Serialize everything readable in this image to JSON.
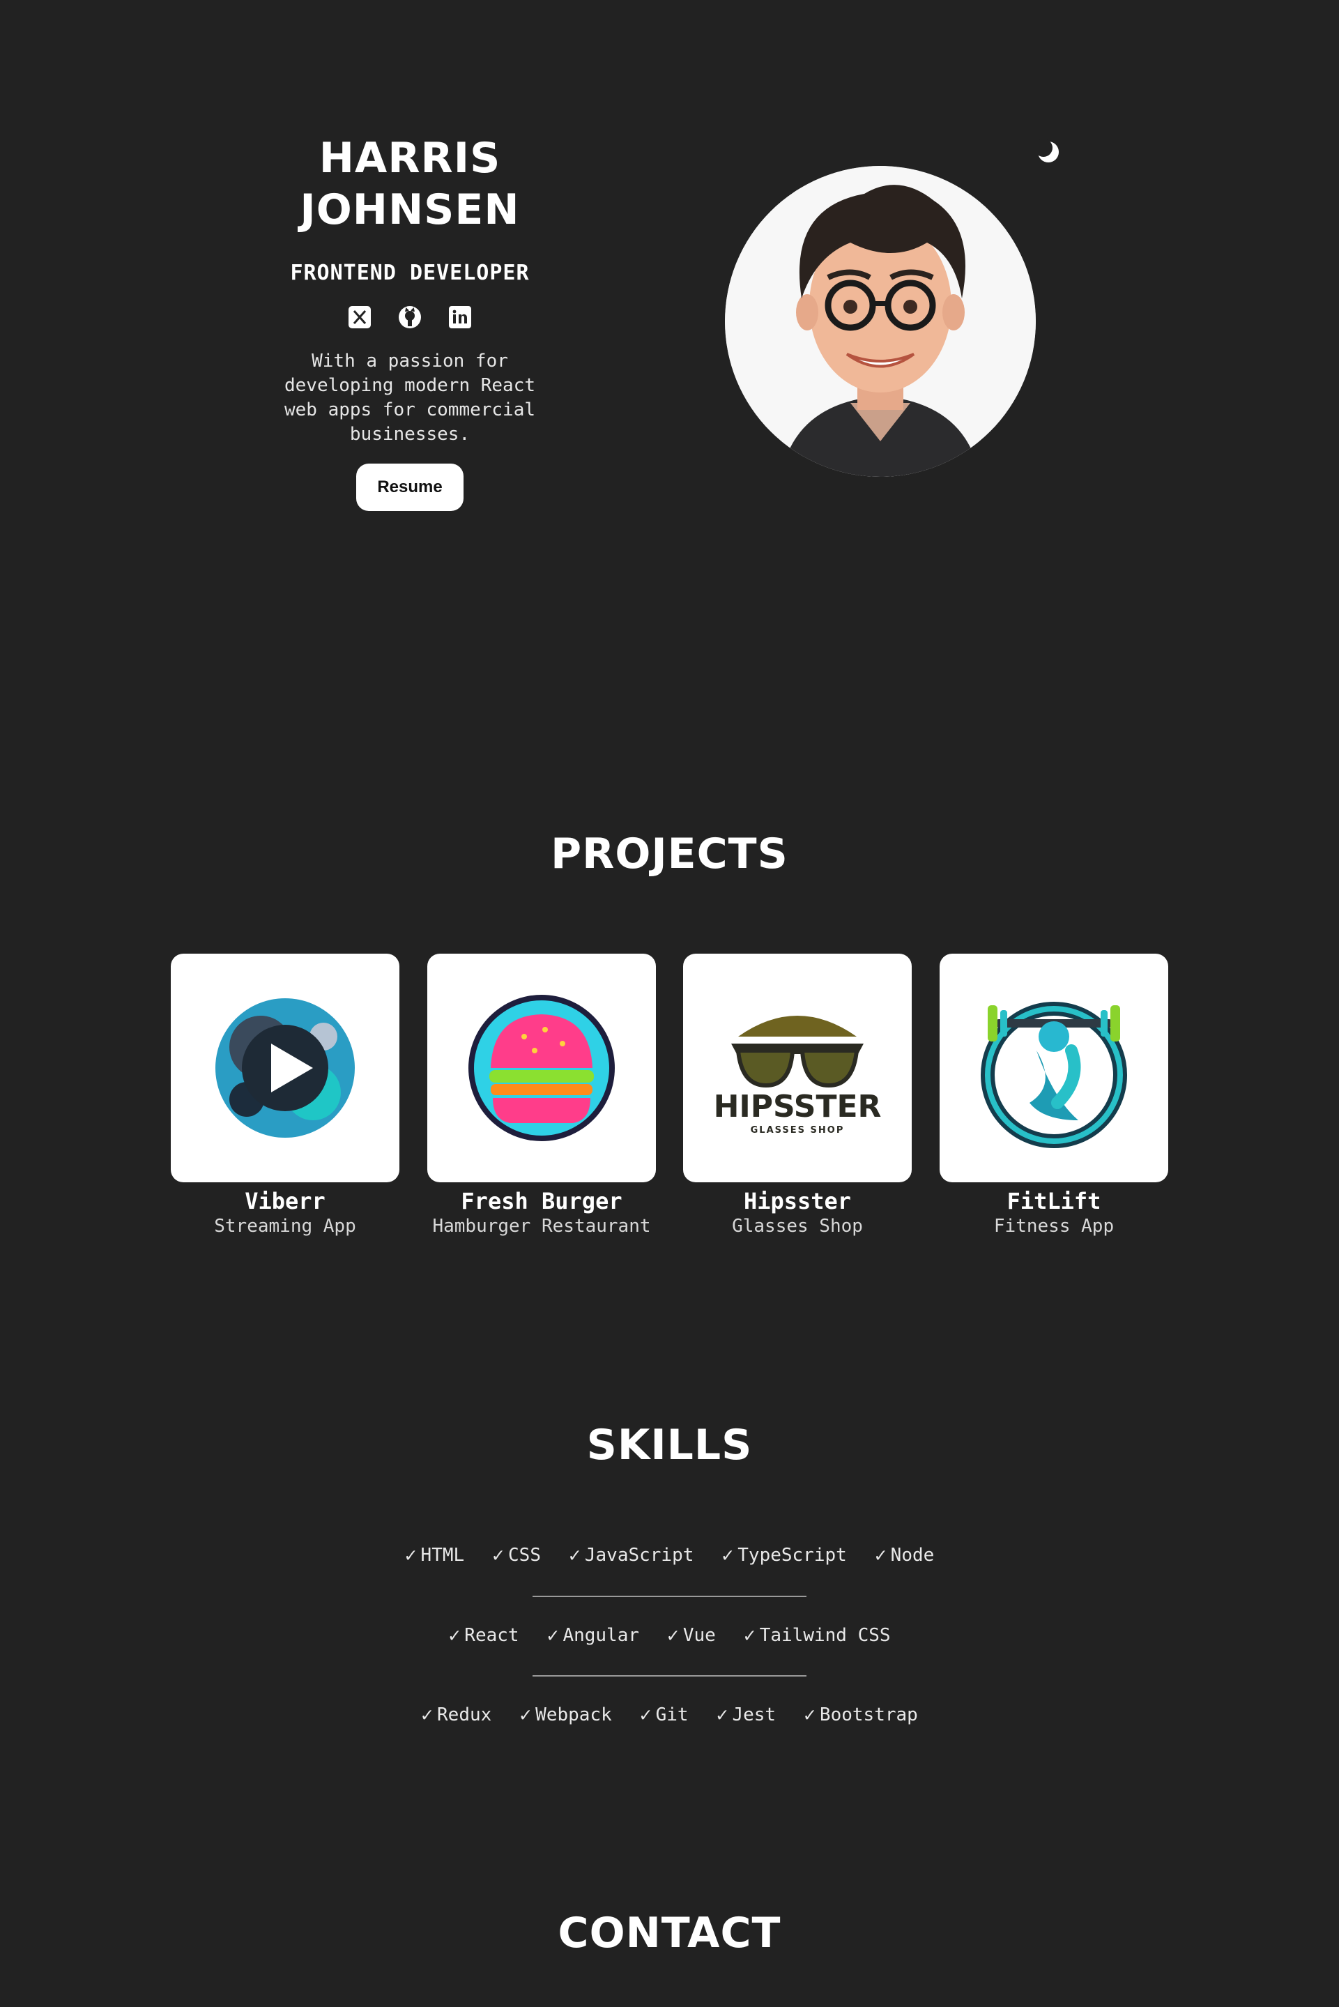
{
  "hero": {
    "name_line1": "HARRIS",
    "name_line2": "JOHNSEN",
    "role": "FRONTEND DEVELOPER",
    "bio": "With a passion for developing modern React web apps for commercial businesses.",
    "resume_label": "Resume",
    "socials": [
      "x-icon",
      "github-icon",
      "linkedin-icon"
    ]
  },
  "sections": {
    "projects": "PROJECTS",
    "skills": "SKILLS",
    "contact": "CONTACT"
  },
  "projects": [
    {
      "name": "Viberr",
      "subtitle": "Streaming App",
      "icon": "streaming-app-logo"
    },
    {
      "name": "Fresh Burger",
      "subtitle": "Hamburger Restaurant",
      "icon": "burger-logo"
    },
    {
      "name": "Hipsster",
      "subtitle": "Glasses Shop",
      "icon": "sunglasses-logo",
      "logo_text": "HIPSSTER",
      "logo_subtext": "GLASSES SHOP"
    },
    {
      "name": "FitLift",
      "subtitle": "Fitness App",
      "icon": "dumbbell-logo"
    }
  ],
  "skills": {
    "row1": [
      "HTML",
      "CSS",
      "JavaScript",
      "TypeScript",
      "Node"
    ],
    "row2": [
      "React",
      "Angular",
      "Vue",
      "Tailwind CSS"
    ],
    "row3": [
      "Redux",
      "Webpack",
      "Git",
      "Jest",
      "Bootstrap"
    ]
  },
  "colors": {
    "background": "#222222",
    "text": "#ffffff",
    "card": "#ffffff"
  }
}
